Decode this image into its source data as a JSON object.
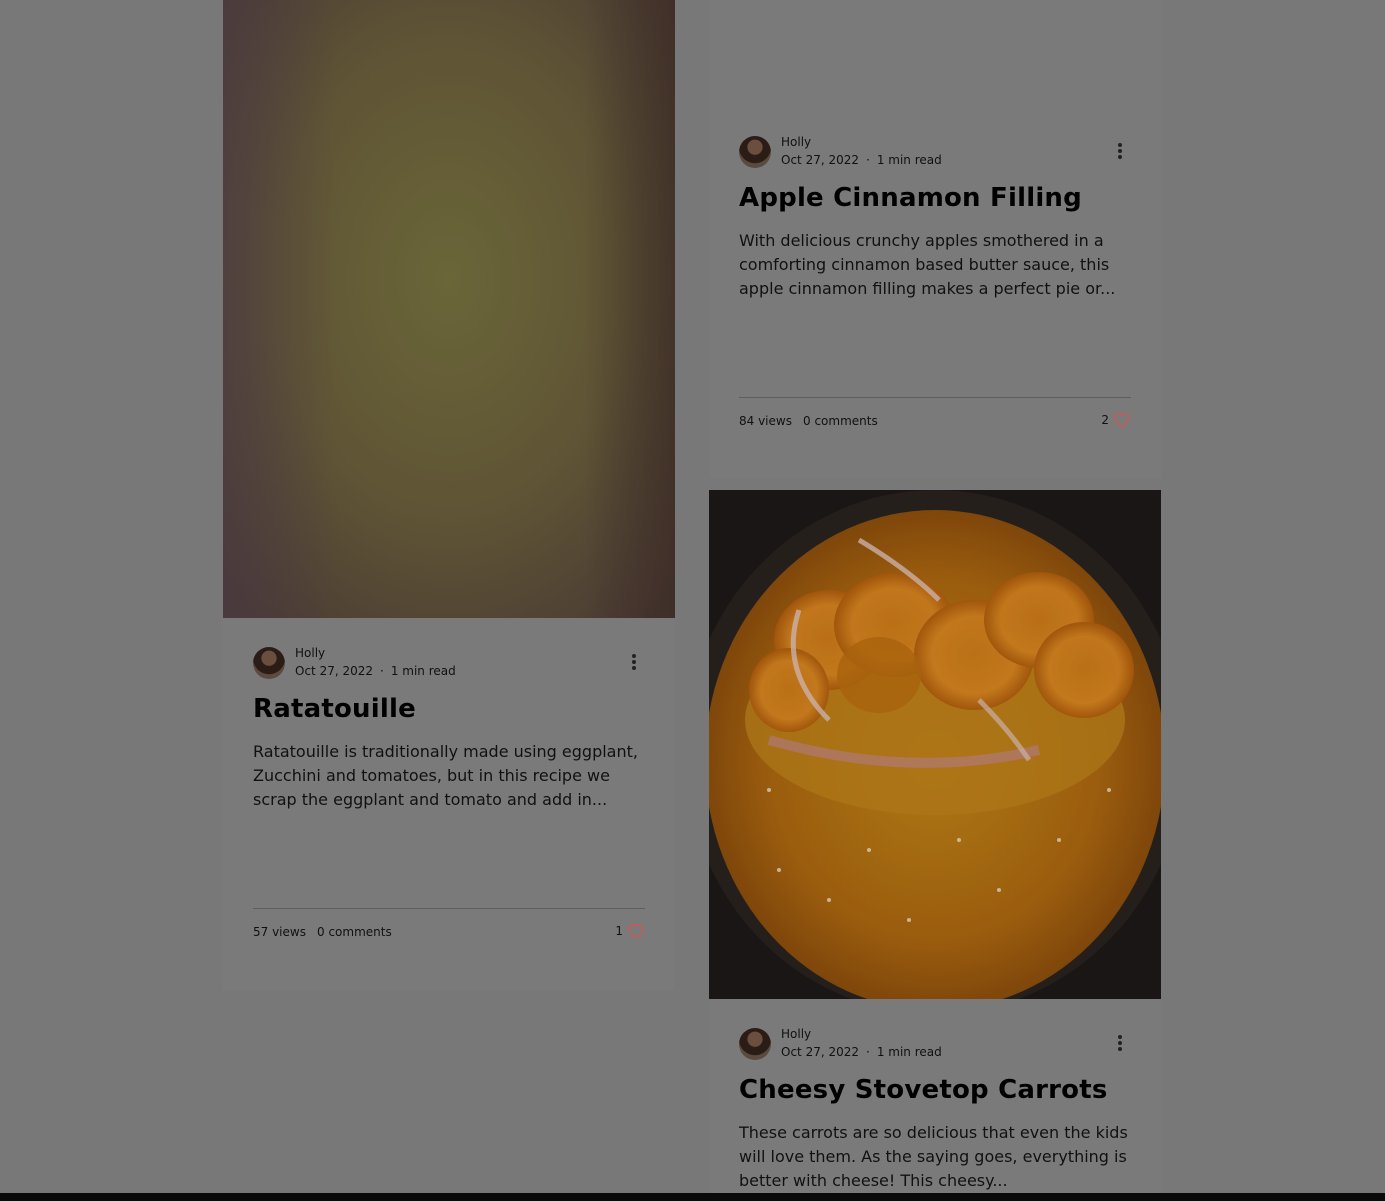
{
  "posts": [
    {
      "author": "Holly",
      "date": "Oct 27, 2022",
      "read_time": "1 min read",
      "title": "Ratatouille",
      "excerpt": "Ratatouille is traditionally made using eggplant, Zucchini and tomatoes, but in this recipe we scrap the eggplant and tomato and add in...",
      "views": "57 views",
      "comments": "0 comments",
      "likes": "1"
    },
    {
      "author": "Holly",
      "date": "Oct 27, 2022",
      "read_time": "1 min read",
      "title": "Apple Cinnamon Filling",
      "excerpt": "With delicious crunchy apples smothered in a comforting cinnamon based butter sauce, this apple cinnamon filling makes a perfect pie or...",
      "views": "84 views",
      "comments": "0 comments",
      "likes": "2"
    },
    {
      "author": "Holly",
      "date": "Oct 27, 2022",
      "read_time": "1 min read",
      "title": "Cheesy Stovetop Carrots",
      "excerpt": "These carrots are so delicious that even the kids will love them. As the saying goes, everything is better with cheese! This cheesy..."
    }
  ],
  "colors": {
    "overlay_background": "#787878",
    "heart_accent": "#d9534f"
  },
  "icons": {
    "more": "more-vertical-icon",
    "like": "heart-icon"
  }
}
